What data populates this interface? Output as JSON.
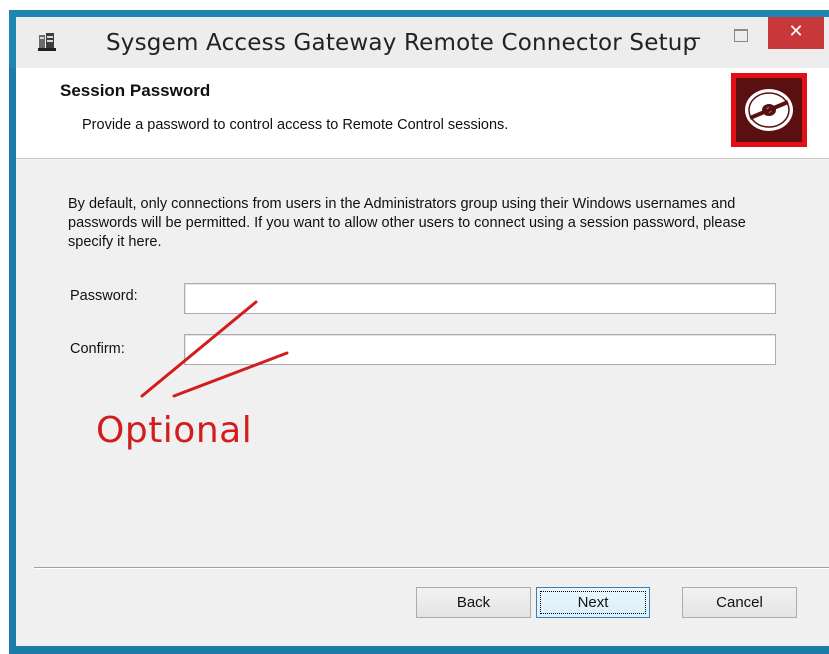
{
  "window": {
    "title": "Sysgem Access Gateway Remote Connector Setup",
    "icon": "installer-package-icon",
    "minimize_glyph": "–",
    "close_glyph": "✕"
  },
  "header": {
    "title": "Session Password",
    "subtitle": "Provide a password to control access to Remote Control sessions.",
    "logo_icon": "disc-logo-icon",
    "logo_color": "#e30e16"
  },
  "body": {
    "description": "By default, only connections from users in the Administrators group using their Windows usernames and passwords will be permitted.  If you want to allow other users to connect using a session password, please specify it here."
  },
  "form": {
    "password_label": "Password:",
    "password_value": "",
    "confirm_label": "Confirm:",
    "confirm_value": ""
  },
  "annotation": {
    "text": "Optional",
    "color": "#d11d1d"
  },
  "buttons": {
    "back": "Back",
    "next": "Next",
    "cancel": "Cancel"
  }
}
